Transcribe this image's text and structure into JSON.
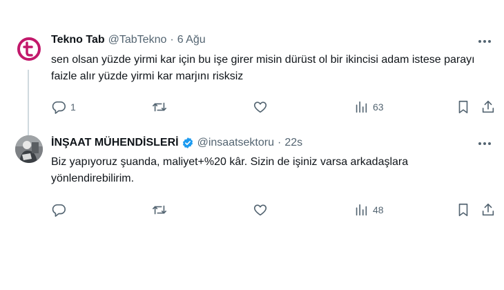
{
  "tweets": [
    {
      "name": "Tekno Tab",
      "handle": "@TabTekno",
      "separator": "·",
      "time": "6 Ağu",
      "text": "sen olsan yüzde yirmi kar için bu işe girer misin dürüst ol bir ikincisi adam istese parayı faizle alır yüzde yirmi kar marjını risksiz",
      "reply_count": "1",
      "view_count": "63",
      "avatar_logo_color": "#c2186b"
    },
    {
      "name": "İNŞAAT MÜHENDİSLERİ",
      "handle": "@insaatsektoru",
      "separator": "·",
      "time": "22s",
      "text": "Biz yapıyoruz şuanda, maliyet+%20 kâr. Sizin de işiniz varsa arkadaşlara yönlendirebilirim.",
      "reply_count": "",
      "view_count": "48",
      "verified_color": "#1d9bf0"
    }
  ],
  "icons": {
    "reply": "reply-icon",
    "retweet": "retweet-icon",
    "like": "heart-icon",
    "views": "views-icon",
    "bookmark": "bookmark-icon",
    "share": "share-icon",
    "more": "more-icon"
  }
}
